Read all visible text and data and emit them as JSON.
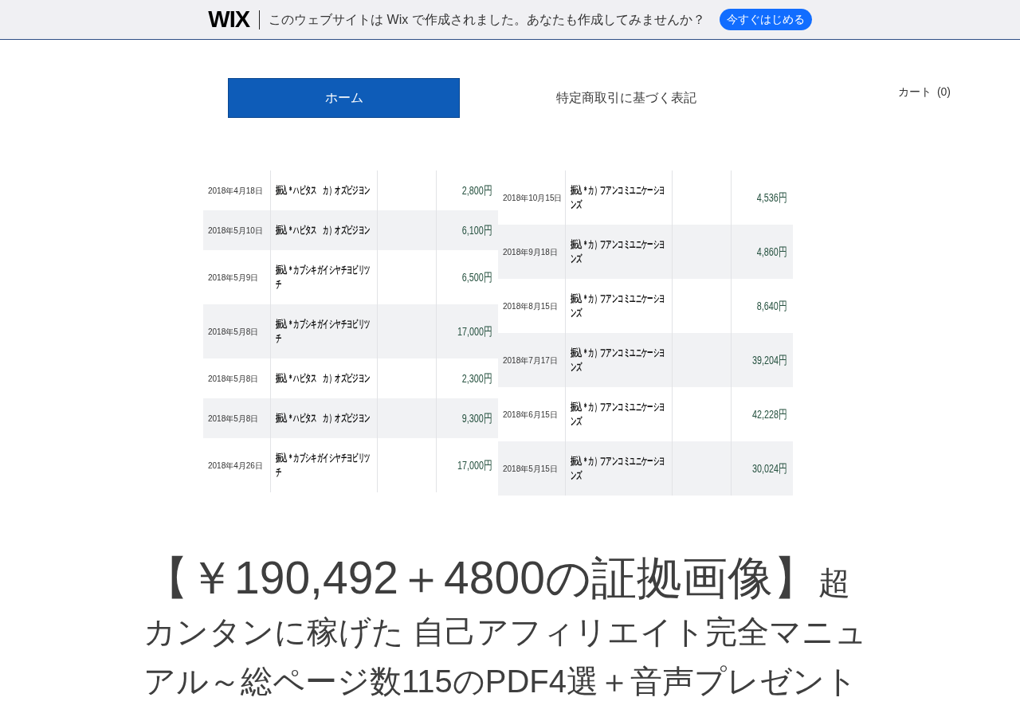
{
  "banner": {
    "logo": "WIX",
    "message": "このウェブサイトは Wix で作成されました。あなたも作成してみませんか？",
    "button": "今すぐはじめる"
  },
  "nav": {
    "tabs": [
      {
        "label": "ホーム",
        "selected": true
      },
      {
        "label": "特定商取引に基づく表記",
        "selected": false
      }
    ],
    "cart": {
      "label": "カート",
      "count": "(0)"
    }
  },
  "statement_image": {
    "left_rows": [
      {
        "date": "2018年4月18日",
        "payee": "振込＊ハピタス　カ）オズビジヨン",
        "amount": "2,800円"
      },
      {
        "date": "2018年5月10日",
        "payee": "振込＊ハピタス　カ）オズビジヨン",
        "amount": "6,100円"
      },
      {
        "date": "2018年5月9日",
        "payee": "振込＊カブシキガイシヤチヨビリツチ",
        "amount": "6,500円"
      },
      {
        "date": "2018年5月8日",
        "payee": "振込＊カブシキガイシヤチヨビリツチ",
        "amount": "17,000円"
      },
      {
        "date": "2018年5月8日",
        "payee": "振込＊ハピタス　カ）オズビジヨン",
        "amount": "2,300円"
      },
      {
        "date": "2018年5月8日",
        "payee": "振込＊ハピタス　カ）オズビジヨン",
        "amount": "9,300円"
      },
      {
        "date": "2018年4月26日",
        "payee": "振込＊カブシキガイシヤチヨビリツチ",
        "amount": "17,000円"
      }
    ],
    "right_rows": [
      {
        "date": "2018年10月15日",
        "payee": "振込＊カ）フアンコミユニケーシヨンズ",
        "amount": "4,536円"
      },
      {
        "date": "2018年9月18日",
        "payee": "振込＊カ）フアンコミユニケーシヨンズ",
        "amount": "4,860円"
      },
      {
        "date": "2018年8月15日",
        "payee": "振込＊カ）フアンコミユニケーシヨンズ",
        "amount": "8,640円"
      },
      {
        "date": "2018年7月17日",
        "payee": "振込＊カ）フアンコミユニケーシヨンズ",
        "amount": "39,204円"
      },
      {
        "date": "2018年6月15日",
        "payee": "振込＊カ）フアンコミユニケーシヨンズ",
        "amount": "42,228円"
      },
      {
        "date": "2018年5月15日",
        "payee": "振込＊カ）フアンコミユニケーシヨンズ",
        "amount": "30,024円"
      }
    ]
  },
  "headline": {
    "lead": "【￥190,492＋4800の証拠画像】",
    "rest": "超カンタンに稼げた 自己アフィリエイト完全マニュアル～総ページ数115のPDF4選＋音声プレゼント"
  }
}
